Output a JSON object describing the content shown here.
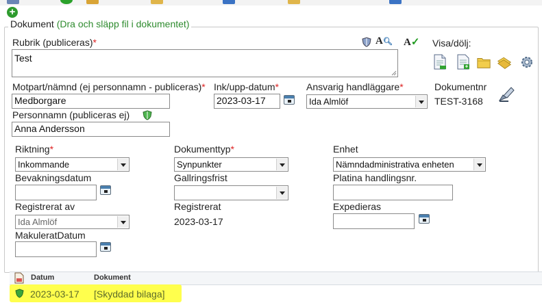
{
  "section": {
    "title": "Dokument",
    "hint": "(Dra och släpp fil i dokumentet)"
  },
  "rubrik": {
    "label": "Rubrik (publiceras)",
    "required": "*",
    "value": "Test"
  },
  "visa_dolj": {
    "label": "Visa/dölj:"
  },
  "motpart": {
    "label": "Motpart/nämnd (ej personnamn - publiceras)",
    "required": "*",
    "value": "Medborgare"
  },
  "ink_datum": {
    "label": "Ink/upp-datum",
    "required": "*",
    "value": "2023-03-17"
  },
  "handlaggare": {
    "label": "Ansvarig handläggare",
    "required": "*",
    "value": "Ida Almlöf"
  },
  "dokumentnr": {
    "label": "Dokumentnr",
    "value": "TEST-3168"
  },
  "personnamn": {
    "label": "Personnamn (publiceras ej)",
    "value": "Anna Andersson"
  },
  "riktning": {
    "label": "Riktning",
    "required": "*",
    "value": "Inkommande"
  },
  "dokumenttyp": {
    "label": "Dokumenttyp",
    "required": "*",
    "value": "Synpunkter"
  },
  "enhet": {
    "label": "Enhet",
    "value": "Nämndadministrativa enheten"
  },
  "bevakningsdatum": {
    "label": "Bevakningsdatum",
    "value": ""
  },
  "gallringsfrist": {
    "label": "Gallringsfrist",
    "value": ""
  },
  "platina": {
    "label": "Platina handlingsnr.",
    "value": ""
  },
  "registrerat_av": {
    "label": "Registrerat av",
    "value": "Ida Almlöf"
  },
  "registrerat": {
    "label": "Registrerat",
    "value": "2023-03-17"
  },
  "expedieras": {
    "label": "Expedieras",
    "value": ""
  },
  "makulerat": {
    "label": "MakuleratDatum",
    "value": ""
  },
  "grid": {
    "col_datum": "Datum",
    "col_dokument": "Dokument",
    "rows": [
      {
        "datum": "2023-03-17",
        "dokument": "[Skyddad bilaga]"
      }
    ]
  },
  "colors": {
    "accent_green": "#2e8b2e",
    "required_red": "#dd2222",
    "highlight_yellow": "#ffff3a"
  },
  "icons": {
    "add": "add-icon",
    "shield": "shield-icon",
    "font_search": "font-search-icon",
    "spellcheck": "spellcheck-icon",
    "calendar": "calendar-icon",
    "edit": "edit-icon",
    "settings": "gear-icon"
  }
}
